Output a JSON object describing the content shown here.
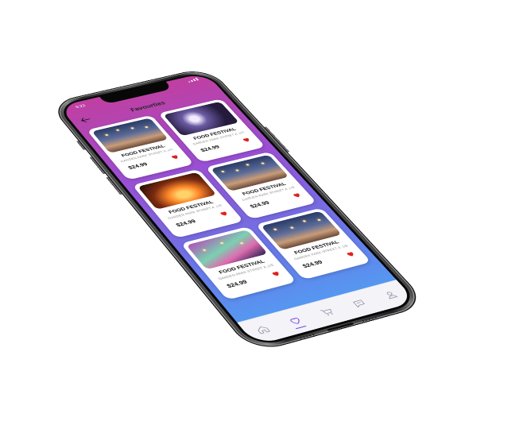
{
  "status_bar": {
    "time": "9:22"
  },
  "header": {
    "back_icon": "arrow-left-icon",
    "title": "Favourties"
  },
  "cards": [
    {
      "image": "night fair",
      "title": "FOOD FESTIVAL",
      "address": "GARDEN PARK STREET A ,US",
      "price": "$24.99",
      "favourite": true
    },
    {
      "image": "party",
      "title": "FOOD FESTIVAL",
      "address": "GARDEN PARK STREET A ,US",
      "price": "$24.99",
      "favourite": true
    },
    {
      "image": "concert",
      "title": "FOOD FESTIVAL",
      "address": "GARDEN PARK STREET A ,US",
      "price": "$24.99",
      "favourite": true
    },
    {
      "image": "night fair",
      "title": "FOOD FESTIVAL",
      "address": "GARDEN PARK STREET A ,US",
      "price": "$24.99",
      "favourite": true
    },
    {
      "image": "party",
      "title": "FOOD FESTIVAL",
      "address": "GARDEN PARK STREET A ,US",
      "price": "$24.99",
      "favourite": true
    },
    {
      "image": "night fair",
      "title": "FOOD FESTIVAL",
      "address": "GARDEN PARK STREET A ,US",
      "price": "$24.99",
      "favourite": true
    }
  ],
  "bottom_nav": {
    "items": [
      {
        "icon": "home-icon",
        "active": false
      },
      {
        "icon": "heart-icon",
        "active": true
      },
      {
        "icon": "cart-icon",
        "active": false
      },
      {
        "icon": "chat-icon",
        "active": false
      },
      {
        "icon": "profile-icon",
        "active": false
      }
    ]
  },
  "colors": {
    "gradient_top": "#c03fa1",
    "gradient_mid": "#9a4fd3",
    "gradient_bottom": "#4da5f4",
    "heart": "#e02020",
    "active_nav": "#7a56e8"
  }
}
